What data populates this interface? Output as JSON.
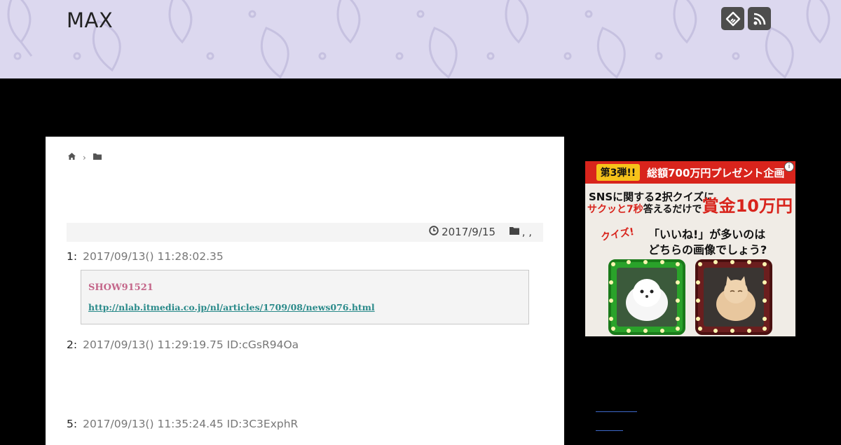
{
  "header": {
    "site_title": "MAX",
    "icons": [
      "feedly-icon",
      "rss-icon"
    ],
    "background": "#dcd8ef"
  },
  "breadcrumb": {
    "icons": [
      "home-icon",
      "chevron-right-icon",
      "folder-icon"
    ]
  },
  "meta": {
    "date": "2017/9/15",
    "categories": ", ,"
  },
  "posts": [
    {
      "num": "1:",
      "info": "2017/09/13() 11:28:02.35"
    },
    {
      "num": "2:",
      "info": "2017/09/13() 11:29:19.75 ID:cGsR94Oa"
    },
    {
      "num": "5:",
      "info": "2017/09/13() 11:35:24.45 ID:3C3ExphR"
    }
  ],
  "quote": {
    "name": "SHOW91521",
    "link": "http://nlab.itmedia.co.jp/nl/articles/1709/08/news076.html"
  },
  "ad": {
    "badge": "第3弾!!",
    "top_text": "総額700万円プレゼント企画",
    "line1": "SNSに関する2択クイズに",
    "line2_red": "サクッと7秒",
    "line2_rest": "答えるだけで",
    "prize": "賞金10万円",
    "quiz_label": "クイズ!",
    "question1": "「いいね!」が多いのは",
    "question2": "どちらの画像でしょう?",
    "info": "i"
  },
  "colors": {
    "accent_link": "#2a8a8a",
    "quote_name": "#c4668a",
    "ad_red": "#d8241c"
  }
}
